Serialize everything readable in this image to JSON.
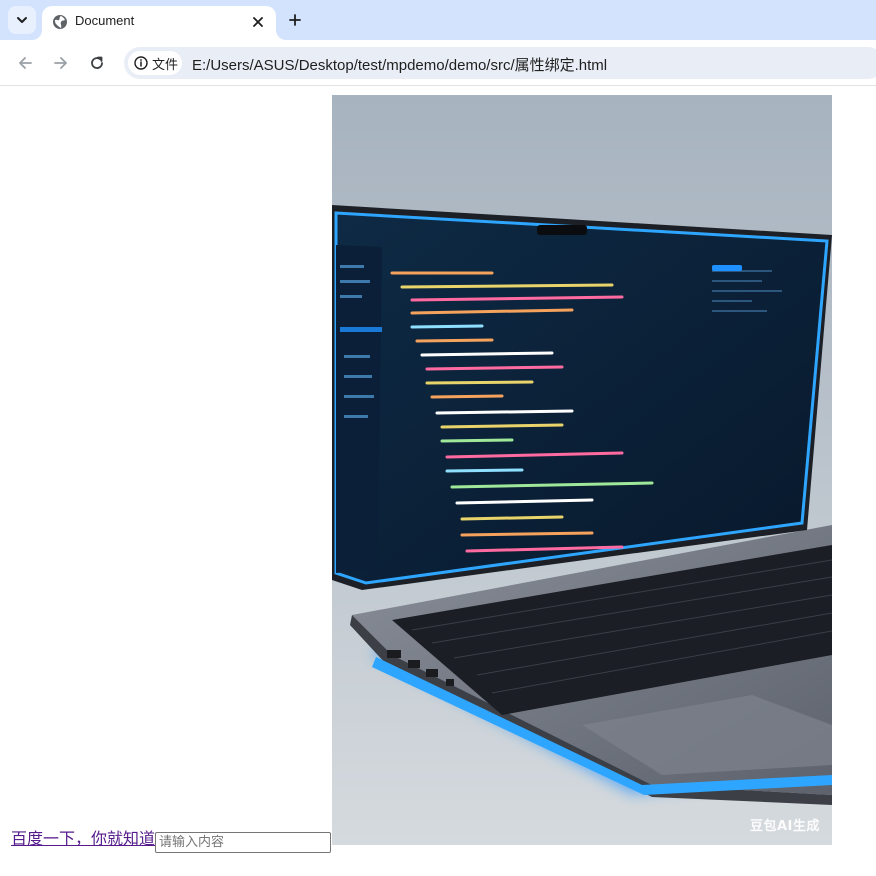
{
  "browser": {
    "tab": {
      "title": "Document"
    },
    "address": {
      "security_chip_label": "文件",
      "url": "E:/Users/ASUS/Desktop/test/mpdemo/demo/src/属性绑定.html"
    }
  },
  "page": {
    "link": {
      "text": "百度一下，你就知道"
    },
    "input": {
      "placeholder": "请输入内容",
      "value": ""
    },
    "image": {
      "description_icon": "laptop-code-photo",
      "watermark": "豆包AI生成"
    }
  },
  "colors": {
    "tabstrip": "#d3e3fd",
    "omnibox": "#e9eef6",
    "visited_link": "#551a8b",
    "glow": "#1e90ff"
  }
}
